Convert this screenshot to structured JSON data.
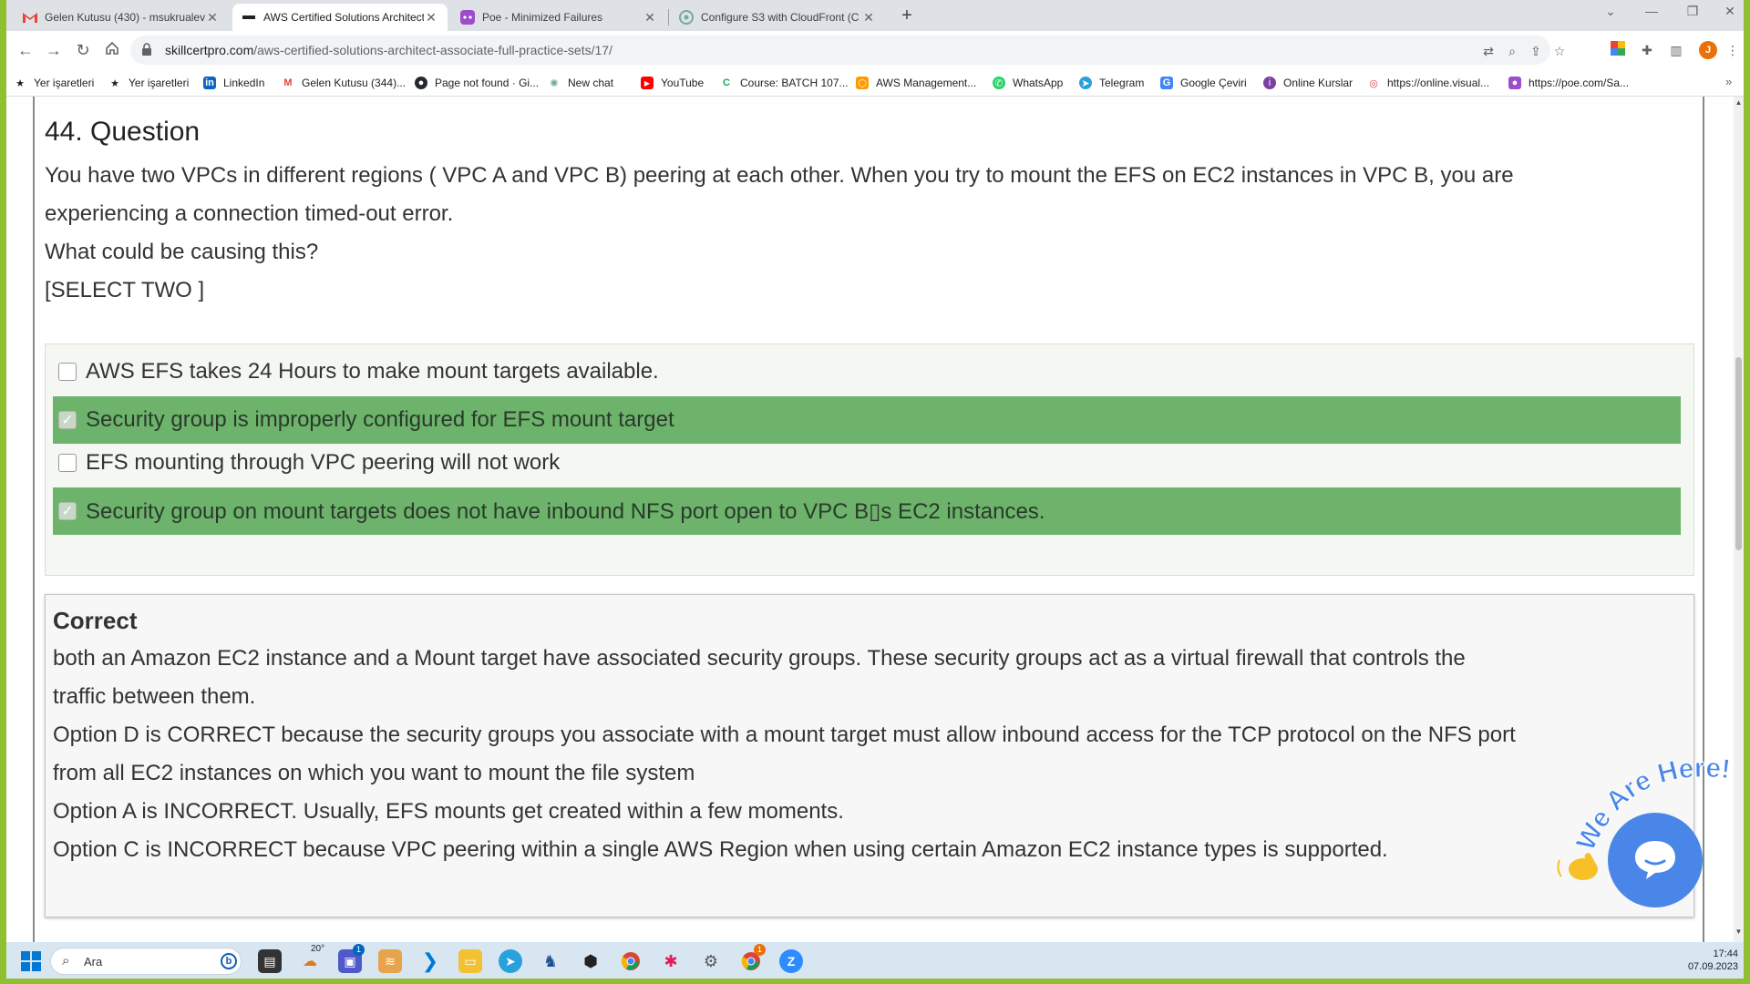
{
  "tabs": [
    {
      "title": "Gelen Kutusu (430) - msukrualev",
      "icon": "gmail-icon",
      "active": false
    },
    {
      "title": "AWS Certified Solutions Architect",
      "icon": "skillcertpro-icon",
      "active": true
    },
    {
      "title": "Poe - Minimized Failures",
      "icon": "poe-icon",
      "active": false
    },
    {
      "title": "Configure S3 with CloudFront (C",
      "icon": "chatgpt-icon",
      "active": false
    }
  ],
  "address": {
    "domain": "skillcertpro.com",
    "path": "/aws-certified-solutions-architect-associate-full-practice-sets/17/"
  },
  "bookmarks": [
    {
      "label": "Yer işaretleri",
      "icon": "star-icon"
    },
    {
      "label": "Yer işaretleri",
      "icon": "star-icon"
    },
    {
      "label": "LinkedIn",
      "icon": "linkedin-icon"
    },
    {
      "label": "Gelen Kutusu (344)...",
      "icon": "gmail-icon"
    },
    {
      "label": "Page not found · Gi...",
      "icon": "github-icon"
    },
    {
      "label": "New chat",
      "icon": "chatgpt-icon"
    },
    {
      "label": "YouTube",
      "icon": "youtube-icon"
    },
    {
      "label": "Course: BATCH 107...",
      "icon": "course-icon"
    },
    {
      "label": "AWS Management...",
      "icon": "aws-icon"
    },
    {
      "label": "WhatsApp",
      "icon": "whatsapp-icon"
    },
    {
      "label": "Telegram",
      "icon": "telegram-icon"
    },
    {
      "label": "Google Çeviri",
      "icon": "google-translate-icon"
    },
    {
      "label": "Online Kurslar",
      "icon": "online-courses-icon"
    },
    {
      "label": "https://online.visual...",
      "icon": "visual-paradigm-icon"
    },
    {
      "label": "https://poe.com/Sa...",
      "icon": "poe-icon"
    }
  ],
  "question": {
    "title": "44. Question",
    "lines": [
      "You have two VPCs in different regions ( VPC A and VPC B) peering at each other. When you try to mount the EFS on EC2 instances in VPC B, you are",
      "experiencing a connection timed-out error.",
      "What could be causing this?",
      "[SELECT TWO ]"
    ]
  },
  "answers": [
    {
      "label": "AWS EFS takes 24 Hours to make mount targets available.",
      "checked": false
    },
    {
      "label": "Security group is improperly configured for EFS mount target",
      "checked": true
    },
    {
      "label": "EFS mounting through VPC peering will not work",
      "checked": false
    },
    {
      "label": "Security group on mount targets does not have inbound NFS port open to VPC B▯s EC2 instances.",
      "checked": true
    }
  ],
  "explanation": {
    "title": "Correct",
    "lines": [
      "both an Amazon EC2 instance and a Mount target have associated security groups. These security groups act as a virtual firewall that controls the",
      "traffic between them.",
      "Option D is CORRECT because the security groups you associate with a mount target must allow inbound access for the TCP protocol on the NFS port",
      "from all EC2 instances on which you want to mount the file system",
      "Option A is INCORRECT. Usually, EFS mounts get created within a few moments.",
      "Option C is INCORRECT because VPC peering within a single AWS Region when using certain Amazon EC2 instance types is supported."
    ]
  },
  "chat_widget": {
    "text": "We Are Here!"
  },
  "taskbar": {
    "search_placeholder": "Ara",
    "weather": "20°",
    "time": "17:44",
    "date": "07.09.2023",
    "teams_badge": "1",
    "chrome_badge": "1"
  },
  "colors": {
    "correct_answer_bg": "#6db36c",
    "page_frame": "#8fc031",
    "chat_blue": "#4a86e8"
  }
}
